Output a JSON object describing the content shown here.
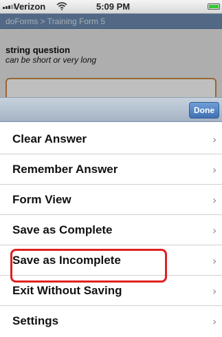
{
  "status_bar": {
    "carrier": "Verizon",
    "time": "5:09 PM",
    "signal_icon": "signal-bars-icon",
    "wifi_icon": "wifi-icon",
    "battery_icon": "battery-icon",
    "battery_level": 1.0
  },
  "breadcrumb": "doForms > Training Form 5",
  "question": {
    "title": "string question",
    "hint": "can be short or very long"
  },
  "toolbar": {
    "done_label": "Done"
  },
  "menu": {
    "items": [
      {
        "label": "Clear Answer"
      },
      {
        "label": "Remember Answer"
      },
      {
        "label": "Form View"
      },
      {
        "label": "Save as Complete"
      },
      {
        "label": "Save as Incomplete"
      },
      {
        "label": "Exit Without Saving"
      },
      {
        "label": "Settings"
      }
    ],
    "chevron": "›"
  },
  "colors": {
    "highlight": "#e02020",
    "crumb_bar": "#6c8db2",
    "done_button": "#3f70b3",
    "answer_border": "#c98a43"
  }
}
